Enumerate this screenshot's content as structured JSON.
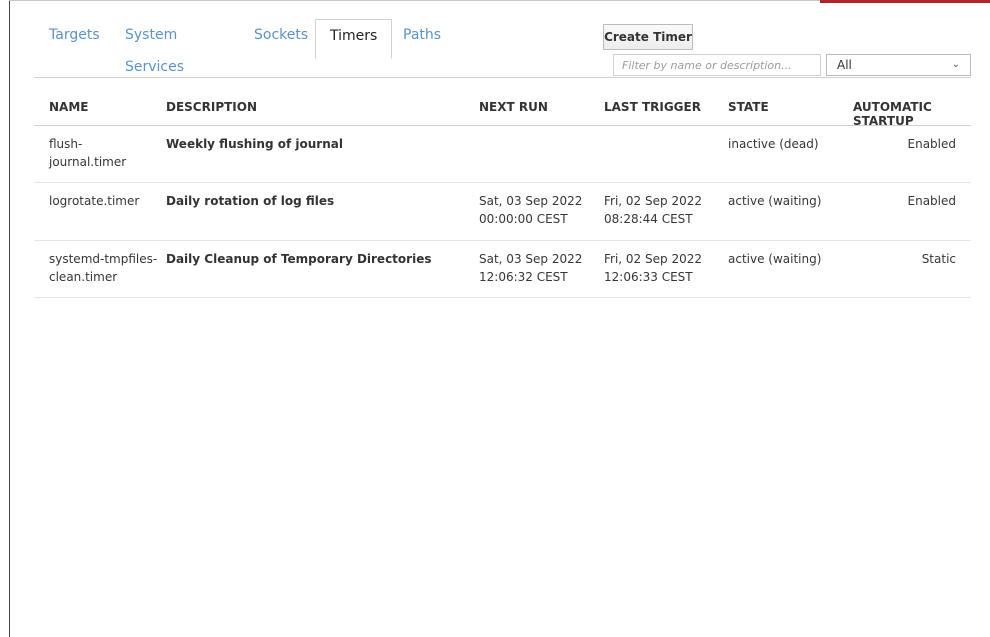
{
  "tabs": [
    {
      "label": "Targets",
      "active": false
    },
    {
      "label": "System Services",
      "active": false
    },
    {
      "label": "Sockets",
      "active": false
    },
    {
      "label": "Timers",
      "active": true
    },
    {
      "label": "Paths",
      "active": false
    }
  ],
  "toolbar": {
    "create_label": "Create Timer",
    "filter_placeholder": "Filter by name or description...",
    "select_value": "All"
  },
  "columns": {
    "name": "NAME",
    "description": "DESCRIPTION",
    "next_run": "NEXT RUN",
    "last_trigger": "LAST TRIGGER",
    "state": "STATE",
    "startup": "AUTOMATIC STARTUP"
  },
  "rows": [
    {
      "name_line1": "flush-",
      "name_line2": "journal.timer",
      "description": "Weekly flushing of journal",
      "next_run_line1": "",
      "next_run_line2": "",
      "last_trigger_line1": "",
      "last_trigger_line2": "",
      "state": "inactive (dead)",
      "startup": "Enabled"
    },
    {
      "name_line1": "logrotate.timer",
      "name_line2": "",
      "description": "Daily rotation of log files",
      "next_run_line1": "Sat, 03 Sep 2022",
      "next_run_line2": "00:00:00 CEST",
      "last_trigger_line1": "Fri, 02 Sep 2022",
      "last_trigger_line2": "08:28:44 CEST",
      "state": "active (waiting)",
      "startup": "Enabled"
    },
    {
      "name_line1": "systemd-tmpfiles-",
      "name_line2": "clean.timer",
      "description": "Daily Cleanup of Temporary Directories",
      "next_run_line1": "Sat, 03 Sep 2022",
      "next_run_line2": "12:06:32 CEST",
      "last_trigger_line1": "Fri, 02 Sep 2022",
      "last_trigger_line2": "12:06:33 CEST",
      "state": "active (waiting)",
      "startup": "Static"
    }
  ],
  "colors": {
    "tab_link": "#5b93c9",
    "accent_bar": "#b2242c"
  }
}
